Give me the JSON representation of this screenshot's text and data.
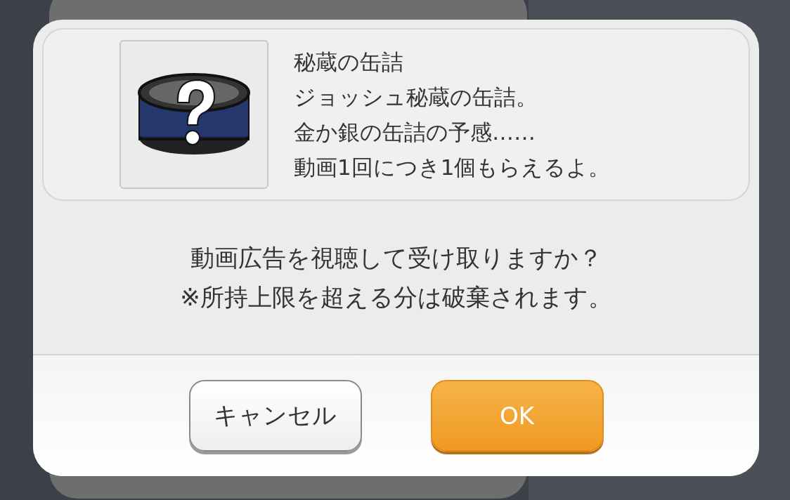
{
  "item": {
    "name": "秘蔵の缶詰",
    "description": [
      "ジョッシュ秘蔵の缶詰。",
      "金か銀の缶詰の予感……",
      "動画1回につき1個もらえるよ。"
    ]
  },
  "message": [
    "動画広告を視聴して受け取りますか？",
    "※所持上限を超える分は破棄されます。"
  ],
  "buttons": [
    {
      "label": "キャンセル",
      "kind": "cancel"
    },
    {
      "label": "OK",
      "kind": "primary"
    }
  ]
}
